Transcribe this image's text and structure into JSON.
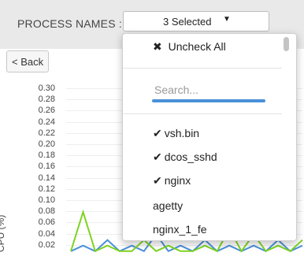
{
  "header": {
    "process_label": "PROCESS NAMES :",
    "select_value": "3 Selected",
    "caret": "▼"
  },
  "back_button": {
    "label": "< Back"
  },
  "dropdown": {
    "uncheck_icon": "✖",
    "uncheck_label": "Uncheck All",
    "search_placeholder": "Search...",
    "check_glyph": "✔",
    "options": [
      {
        "label": "vsh.bin",
        "checked": true
      },
      {
        "label": "dcos_sshd",
        "checked": true
      },
      {
        "label": "nginx",
        "checked": true
      },
      {
        "label": "agetty",
        "checked": false
      },
      {
        "label": "nginx_1_fe",
        "checked": false
      }
    ]
  },
  "chart_data": {
    "type": "line",
    "ylabel": "CPU (%)",
    "y_ticks": [
      "0.30",
      "0.28",
      "0.26",
      "0.24",
      "0.22",
      "0.20",
      "0.18",
      "0.16",
      "0.14",
      "0.12",
      "0.10",
      "0.08",
      "0.06",
      "0.04",
      "0.02"
    ],
    "ylim": [
      0.02,
      0.3
    ],
    "series_colors": [
      "#4a90d9",
      "#7ed321"
    ],
    "series": [
      {
        "values": [
          0.02,
          0.03,
          0.02,
          0.04,
          0.02,
          0.03,
          0.02,
          0.05,
          0.02,
          0.03,
          0.02,
          0.04,
          0.02,
          0.03,
          0.02,
          0.03,
          0.02,
          0.04,
          0.02,
          0.03
        ]
      },
      {
        "values": [
          0.02,
          0.09,
          0.02,
          0.03,
          0.02,
          0.02,
          0.04,
          0.02,
          0.03,
          0.02,
          0.02,
          0.03,
          0.02,
          0.06,
          0.02,
          0.05,
          0.02,
          0.03,
          0.02,
          0.04
        ]
      }
    ]
  }
}
